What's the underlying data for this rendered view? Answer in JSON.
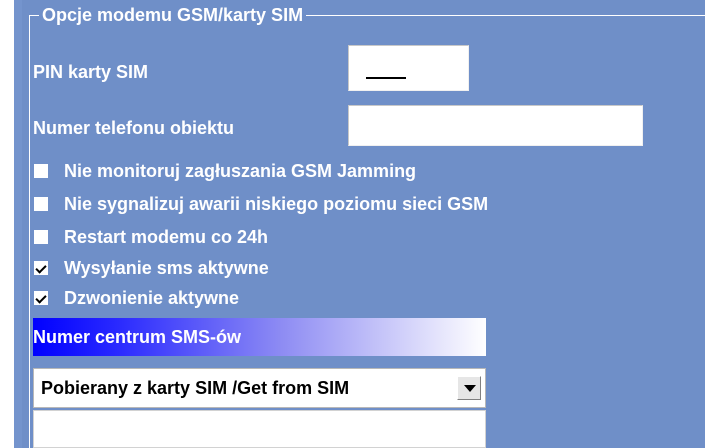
{
  "group": {
    "title": "Opcje modemu GSM/karty SIM"
  },
  "pin": {
    "label": "PIN karty SIM",
    "value": ""
  },
  "phone": {
    "label": "Numer telefonu obiektu",
    "value": ""
  },
  "options": [
    {
      "label": "Nie monitoruj zagłuszania GSM Jamming",
      "checked": false
    },
    {
      "label": "Nie sygnalizuj awarii niskiego poziomu sieci GSM",
      "checked": false
    },
    {
      "label": "Restart modemu co 24h",
      "checked": false
    },
    {
      "label": "Wysyłanie sms aktywne",
      "checked": true
    },
    {
      "label": "Dzwonienie aktywne",
      "checked": true
    }
  ],
  "sms_center": {
    "label": "Numer centrum SMS-ów",
    "selected": "Pobierany z karty SIM /Get from SIM",
    "value": ""
  },
  "colors": {
    "panel_background": "#6f8fc8",
    "header_gradient_start": "#0000ff",
    "header_gradient_end": "#ffffff",
    "text": "#ffffff"
  },
  "icons": {
    "dropdown": "chevron-down-icon",
    "checkmark": "checkmark-icon"
  }
}
